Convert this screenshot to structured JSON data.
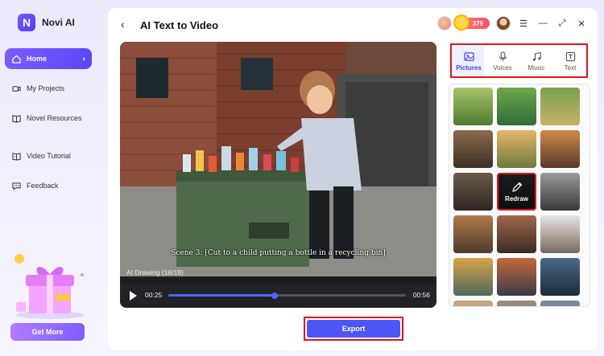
{
  "app": {
    "name": "Novi AI",
    "logo_letter": "N"
  },
  "sidebar": {
    "items": [
      {
        "label": "Home",
        "icon": "home-icon",
        "active": true
      },
      {
        "label": "My Projects",
        "icon": "video-camera-icon"
      },
      {
        "label": "Novel Resources",
        "icon": "book-icon"
      },
      {
        "label": "Video Tutorial",
        "icon": "play-book-icon"
      },
      {
        "label": "Feedback",
        "icon": "chat-icon"
      }
    ],
    "chevron": "›",
    "get_more": "Get More"
  },
  "header": {
    "back": "‹",
    "title": "AI Text to Video",
    "credits": "379",
    "menu_icon": "☰",
    "minimize_icon": "—",
    "expand_icon": "⤢",
    "close_icon": "✕"
  },
  "player": {
    "subtitle": "Scene 3: [Cut to a child putting a bottle in a recycling bin]",
    "caption": "AI Drawing (18/18)",
    "current_time": "00:25",
    "total_time": "00:56",
    "progress": 0.446
  },
  "export": {
    "label": "Export"
  },
  "tabs": [
    {
      "label": "Pictures",
      "active": true,
      "icon": "image-icon"
    },
    {
      "label": "Voices",
      "icon": "microphone-icon"
    },
    {
      "label": "Music",
      "icon": "music-icon"
    },
    {
      "label": "Text",
      "icon": "text-icon"
    }
  ],
  "gallery": {
    "redraw_label": "Redraw",
    "colors": {
      "park": "#6c8f3e",
      "street": "#8a6a4a",
      "room": "#5d5246",
      "city": "#b07a4a",
      "tech": "#2c3140"
    }
  }
}
